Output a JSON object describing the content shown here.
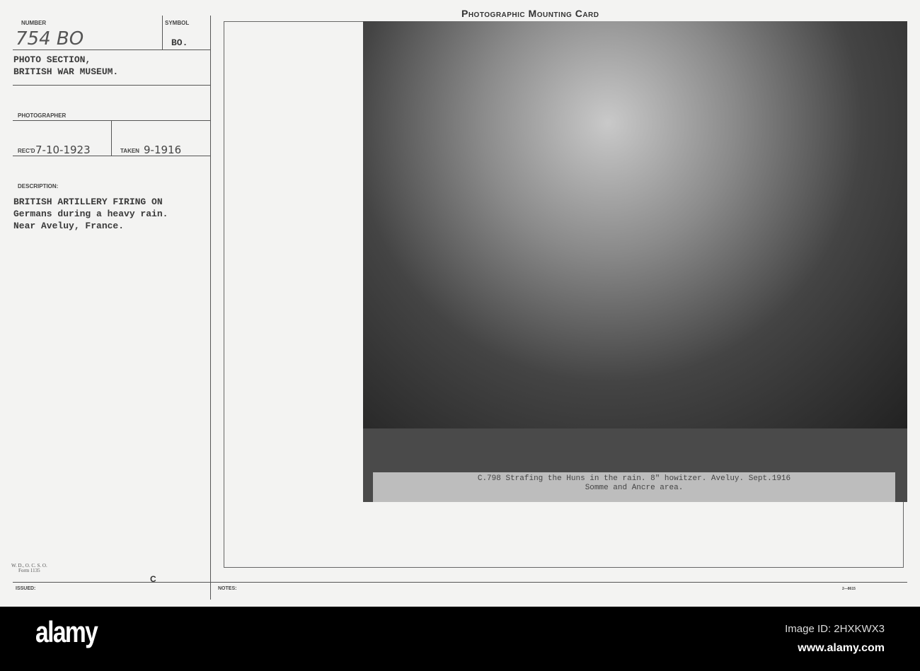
{
  "card": {
    "header": "Photographic Mounting Card",
    "number_label": "NUMBER",
    "number_value": "754 BO",
    "symbol_label": "SYMBOL",
    "symbol_value": "BO.",
    "section_lines": [
      "PHOTO SECTION,",
      "BRITISH WAR MUSEUM."
    ],
    "photographer_label": "PHOTOGRAPHER",
    "received_label": "REC'D",
    "received_value": "7-10-1923",
    "taken_label": "TAKEN",
    "taken_value": "9-1916",
    "description_label": "DESCRIPTION:",
    "description_lines": [
      "BRITISH ARTILLERY FIRING ON",
      "Germans during a heavy rain.",
      "Near Aveluy, France."
    ],
    "form_lines": [
      "W. D., O. C. S. O.",
      "Form 1135"
    ],
    "issued_label": "ISSUED:",
    "issued_mark": "C",
    "notes_label": "NOTES:",
    "print_code": "2—8615"
  },
  "photo": {
    "caption_lines": [
      "C.798  Strafing the Huns in the rain. 8\" howitzer. Aveluy. Sept.1916",
      "Somme and Ancre area."
    ]
  },
  "footer": {
    "logo": "alamy",
    "image_id": "Image ID: 2HXKWX3",
    "site": "www.alamy.com"
  }
}
